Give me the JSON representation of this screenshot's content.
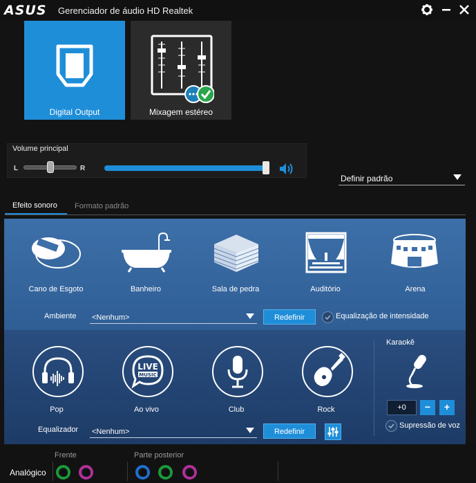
{
  "window": {
    "brand": "ASUS",
    "title": "Gerenciador de áudio HD Realtek"
  },
  "devices": [
    {
      "label": "Digital Output",
      "selected": true
    },
    {
      "label": "Mixagem estéreo",
      "selected": false
    }
  ],
  "volume": {
    "title": "Volume principal",
    "left_label": "L",
    "right_label": "R",
    "balance_fraction": 0.5,
    "level_fraction": 0.99
  },
  "default_device": {
    "label": "Definir padrão"
  },
  "tabs": [
    {
      "label": "Efeito sonoro",
      "active": true
    },
    {
      "label": "Formato padrão",
      "active": false
    }
  ],
  "environments": [
    {
      "label": "Cano de Esgoto",
      "icon": "sewer-pipe-icon"
    },
    {
      "label": "Banheiro",
      "icon": "bathtub-icon"
    },
    {
      "label": "Sala de pedra",
      "icon": "stone-room-icon"
    },
    {
      "label": "Auditório",
      "icon": "auditorium-icon"
    },
    {
      "label": "Arena",
      "icon": "arena-icon"
    }
  ],
  "ambient": {
    "label": "Ambiente",
    "value": "<Nenhum>",
    "reset": "Redefinir",
    "loudness": "Equalização de intensidade"
  },
  "genres": [
    {
      "label": "Pop",
      "icon": "headphones-icon"
    },
    {
      "label": "Ao vivo",
      "icon": "live-music-icon"
    },
    {
      "label": "Club",
      "icon": "microphone-icon"
    },
    {
      "label": "Rock",
      "icon": "guitar-icon"
    }
  ],
  "live_badge": {
    "top": "LIVE",
    "bottom": "MUSIC"
  },
  "equalizer": {
    "label": "Equalizador",
    "value": "<Nenhum>",
    "reset": "Redefinir"
  },
  "karaoke": {
    "title": "Karaokê",
    "value": "+0",
    "minus": "−",
    "plus": "+",
    "voice_cancel": "Supressão de voz"
  },
  "connectors": {
    "analog": "Analógico",
    "front": "Frente",
    "rear": "Parte posterior",
    "colors": {
      "green": "#1a9a3a",
      "pink": "#b0309a",
      "blue": "#1f6fd0"
    }
  }
}
